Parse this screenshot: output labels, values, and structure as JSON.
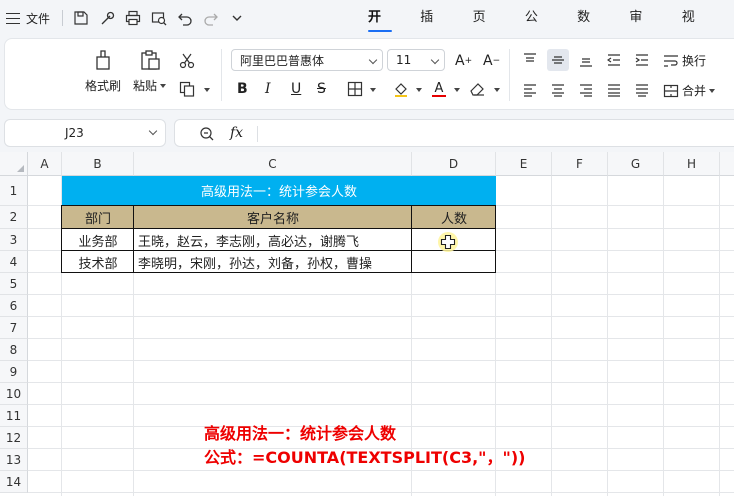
{
  "menubar": {
    "file_label": "文件",
    "tabs": [
      "开始",
      "插入",
      "页面",
      "公式",
      "数据",
      "审阅",
      "视图"
    ],
    "active_tab": "开始"
  },
  "ribbon": {
    "format_painter": "格式刷",
    "paste": "粘贴",
    "font_name": "阿里巴巴普惠体",
    "font_size": "11",
    "wrap_text": "换行",
    "merge": "合并"
  },
  "formula_bar": {
    "name_box": "J23",
    "fx_label": "fx",
    "formula": ""
  },
  "sheet": {
    "columns": [
      "A",
      "B",
      "C",
      "D",
      "E",
      "F",
      "G",
      "H"
    ],
    "rows": [
      "1",
      "2",
      "3",
      "4",
      "5",
      "6",
      "7",
      "8",
      "9",
      "10",
      "11",
      "12",
      "13",
      "14"
    ],
    "table": {
      "title": "高级用法一：统计参会人数",
      "headers": [
        "部门",
        "客户名称",
        "人数"
      ],
      "rows": [
        {
          "dept": "业务部",
          "names": "王晓，赵云，李志刚，高必达，谢腾飞",
          "count": ""
        },
        {
          "dept": "技术部",
          "names": "李晓明，宋刚，孙达，刘备，孙权，曹操",
          "count": ""
        }
      ]
    },
    "note": {
      "line1": "高级用法一：统计参会人数",
      "line2": "公式：=COUNTA(TEXTSPLIT(C3,\"，\"))"
    }
  },
  "colors": {
    "title_fill": "#00b0f0",
    "header_fill": "#c9b88e",
    "note_text": "#ee0000",
    "accent": "#1b6ef3"
  }
}
